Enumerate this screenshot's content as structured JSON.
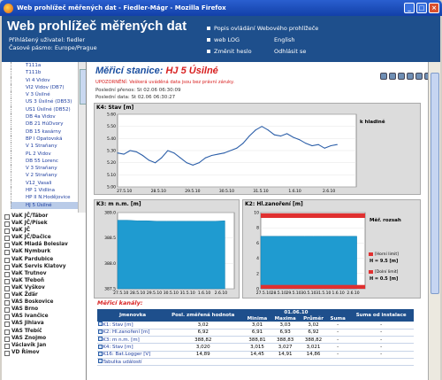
{
  "window": {
    "title": "Web prohlížeč měřených dat - Fiedler-Mágr - Mozilla Firefox"
  },
  "header": {
    "logo": "Web prohlížeč měřených dat",
    "user_line": "Přihlášený uživatel: fiedler",
    "tz_line": "Časové pásmo: Europe/Prague",
    "links": [
      "Popis ovládání Webového prohlížeče",
      "web LOG",
      "Změnit heslo"
    ],
    "links2": [
      "English",
      "Odhlásit se"
    ]
  },
  "sidebar": {
    "tree": [
      "T111a",
      "T111b",
      "Vi 4 Vidov",
      "VI2 Vidov (DB7)",
      "V 3 Úsilné",
      "US 3 Úsilné (DB53)",
      "US1 Úsilné (DB52)",
      "DB 4a Vidov",
      "DB 21 HúDvory",
      "DB 15 kasárny",
      "BP I Opatovská",
      "V 1 Straňany",
      "PL 2 Vidov",
      "DB 55 Lorenc",
      "V 3 Straňany",
      "V 2 Straňany",
      "V12_Vasali",
      "HP 1 Vidlina",
      "HP II N.Hodějovice",
      "HJ 5 Úsilné"
    ],
    "selected": "HJ 5 Úsilné",
    "groups": [
      "VaK JČ/Tábor",
      "VaK JČ/Písek",
      "VaK JČ",
      "VaK JČ/Dačice",
      "VaK Mladá Boleslav",
      "VaK Nymburk",
      "VaK Pardubice",
      "VaK Servis Klatovy",
      "VaK Trutnov",
      "VaK Třeboň",
      "VaK Vyškov",
      "VaK Žďár",
      "VAS Boskovice",
      "VAS Brno",
      "VAS Ivančice",
      "VAS Jihlava",
      "VAS Třebíč",
      "VAS Znojmo",
      "Václavík Jan",
      "VD Římov"
    ]
  },
  "station": {
    "label": "Měřicí stanice:",
    "name": "HJ 5 Úsilné",
    "warning": "UPOZORNĚNÍ: Veškerá uváděná data jsou bez právní záruky.",
    "last_transfer": "Poslední přenos: St 02.06 06:30:09",
    "last_data": "Poslední data: St 02.06 06:30:27"
  },
  "chart_data": [
    {
      "type": "line",
      "title": "K4: Stav [m]",
      "legend": "k hladině",
      "categories": [
        "27.5.10",
        "28.5.10",
        "29.5.10",
        "30.5.10",
        "31.5.10",
        "1.6.10",
        "2.6.10"
      ],
      "yticks": [
        "5.60",
        "5.50",
        "5.40",
        "5.30",
        "5.20",
        "5.10",
        "5.00"
      ],
      "ylim": [
        5.0,
        5.6
      ],
      "values": [
        5.28,
        5.27,
        5.3,
        5.29,
        5.26,
        5.22,
        5.2,
        5.24,
        5.3,
        5.28,
        5.24,
        5.2,
        5.18,
        5.2,
        5.24,
        5.26,
        5.27,
        5.28,
        5.3,
        5.32,
        5.36,
        5.42,
        5.47,
        5.5,
        5.47,
        5.43,
        5.42,
        5.44,
        5.41,
        5.39,
        5.36,
        5.34,
        5.35,
        5.32,
        5.34,
        5.35
      ]
    },
    {
      "type": "area",
      "title": "K3: m n.m. [m]",
      "categories": [
        "27.5.10",
        "28.5.10",
        "29.5.10",
        "30.5.10",
        "31.5.10",
        "1.6.10",
        "2.6.10"
      ],
      "yticks": [
        "389.0",
        "388.5",
        "388.0",
        "387.5"
      ],
      "ylim": [
        387.5,
        389.0
      ],
      "values": [
        388.85,
        388.85,
        388.84,
        388.84,
        388.83,
        388.83,
        388.83,
        388.83,
        388.83,
        388.83,
        388.83,
        388.84
      ]
    },
    {
      "type": "area",
      "title": "K2: Hl.zanoření [m]",
      "legend": "Měř. rozsah",
      "upper_limit_label": "H = 9.5 [m]",
      "lower_limit_label": "H = 0.5 [m]",
      "upper_legend": "[Horní limit]",
      "lower_legend": "[Dolní limit]",
      "categories": [
        "27.5.10",
        "28.5.10",
        "29.5.10",
        "30.5.10",
        "31.5.10",
        "1.6.10",
        "2.6.10"
      ],
      "yticks": [
        "10",
        "8",
        "6",
        "4",
        "2",
        "0"
      ],
      "ylim": [
        0,
        10
      ],
      "values": [
        6.9,
        6.9,
        6.9,
        6.9,
        6.9,
        6.9,
        6.9,
        6.9,
        6.9,
        6.9,
        6.9,
        6.9
      ]
    }
  ],
  "table": {
    "title": "Měřicí kanály:",
    "headers": [
      "",
      "Jmenovka",
      "Posl. změřená hodnota",
      "Minima",
      "Maxima",
      "Průměr",
      "Suma",
      "Suma od instalace"
    ],
    "date_head": "01.06.10",
    "rows": [
      [
        "K1: Stav [m]",
        "3,02",
        "3,01",
        "3,03",
        "3,02",
        "-",
        "-"
      ],
      [
        "K2: Hl.zanoření [m]",
        "6,92",
        "6,91",
        "6,93",
        "6,92",
        "-",
        "-"
      ],
      [
        "K3: m n.m. [m]",
        "388,82",
        "388,81",
        "388,83",
        "388,82",
        "-",
        "-"
      ],
      [
        "K4: Stav [m]",
        "3,020",
        "3,015",
        "3,027",
        "3,021",
        "-",
        "-"
      ],
      [
        "K16: Bat.Logger [V]",
        "14,89",
        "14,45",
        "14,91",
        "14,86",
        "-",
        "-"
      ],
      [
        "Tabulka událostí",
        "",
        "",
        "",
        "",
        "",
        ""
      ]
    ]
  }
}
